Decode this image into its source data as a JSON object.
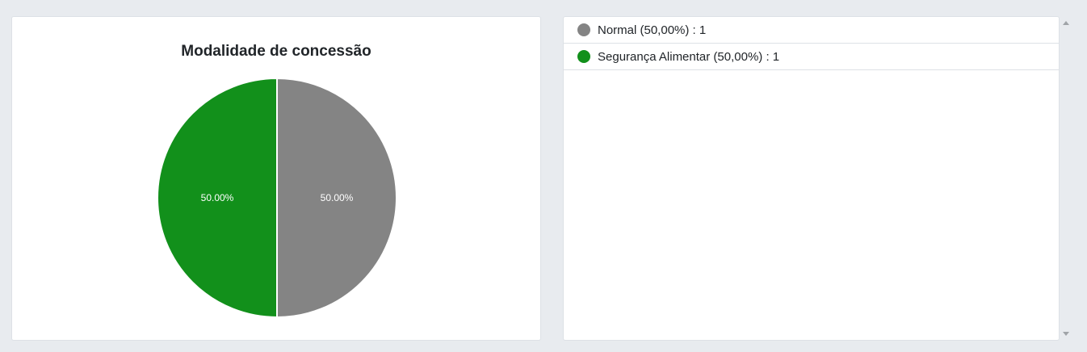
{
  "chart_data": {
    "type": "pie",
    "title": "Modalidade de concessão",
    "slices": [
      {
        "label": "Normal",
        "value": 1,
        "percent_label": "50.00%",
        "color": "#848484"
      },
      {
        "label": "Segurança Alimentar",
        "value": 1,
        "percent_label": "50.00%",
        "color": "#12901b"
      }
    ]
  },
  "legend": {
    "items": [
      {
        "text": "Normal (50,00%) : 1",
        "color": "#848484"
      },
      {
        "text": "Segurança Alimentar (50,00%) : 1",
        "color": "#12901b"
      }
    ]
  }
}
